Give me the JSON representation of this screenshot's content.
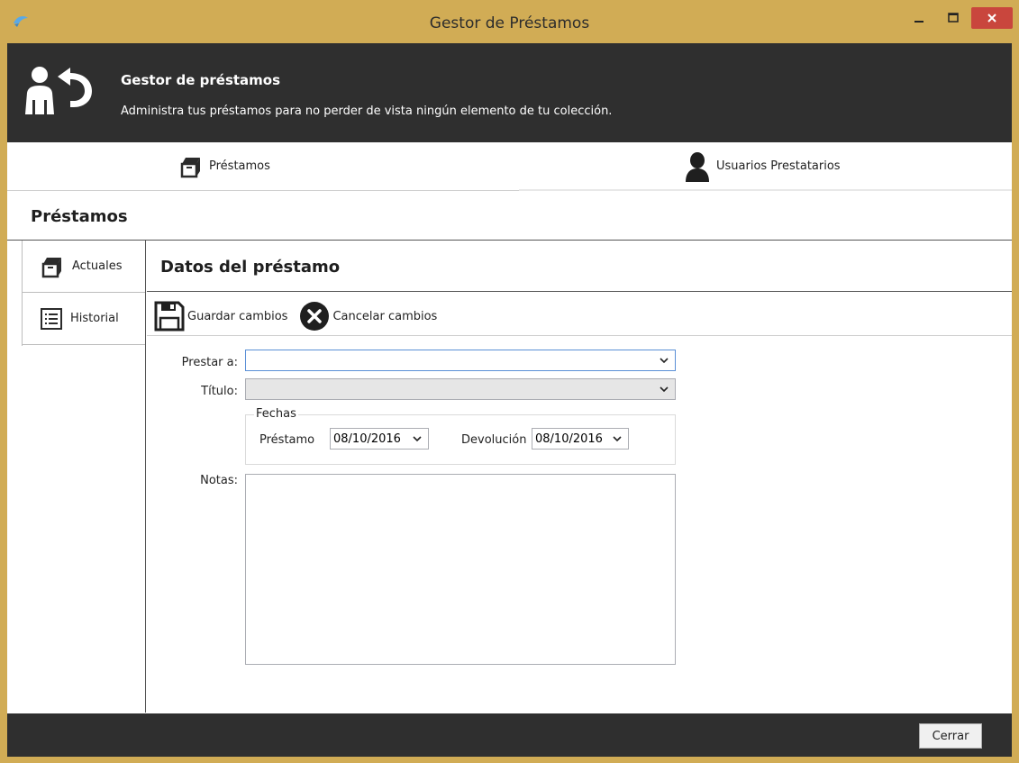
{
  "window": {
    "title": "Gestor de Préstamos",
    "title_color": "#d1ac55",
    "close_color": "#c9463d"
  },
  "header": {
    "title": "Gestor de préstamos",
    "subtitle": "Administra tus préstamos para no perder de vista ningún elemento de tu colección.",
    "icon": "user-return-icon",
    "background": "#2f2f2f"
  },
  "tabs": [
    {
      "label": "Préstamos",
      "icon": "box-icon"
    },
    {
      "label": "Usuarios Prestatarios",
      "icon": "user-icon"
    }
  ],
  "section": {
    "title": "Préstamos"
  },
  "sidenav": {
    "items": [
      {
        "label": "Actuales",
        "icon": "box-icon"
      },
      {
        "label": "Historial",
        "icon": "list-icon"
      }
    ]
  },
  "panel": {
    "title": "Datos del préstamo",
    "toolbar": {
      "save_label": "Guardar cambios",
      "cancel_label": "Cancelar cambios"
    },
    "form": {
      "prestar_label": "Prestar a:",
      "prestar_value": "",
      "titulo_label": "Título:",
      "titulo_value": "",
      "fechas_legend": "Fechas",
      "prestamo_label": "Préstamo",
      "prestamo_date": "08/10/2016",
      "devolucion_label": "Devolución",
      "devolucion_date": "08/10/2016",
      "notas_label": "Notas:",
      "notas_value": ""
    }
  },
  "footer": {
    "close_label": "Cerrar"
  }
}
